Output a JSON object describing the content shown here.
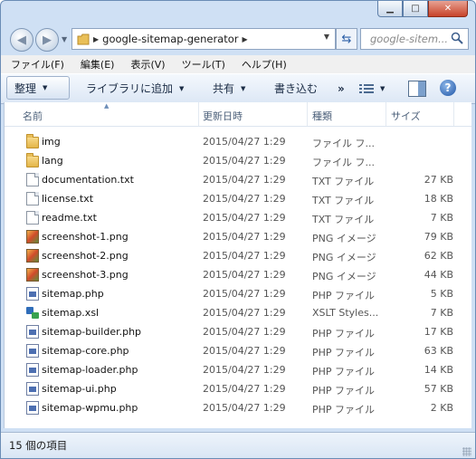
{
  "window": {
    "caption": {
      "minimize": "▁",
      "maximize": "□",
      "close": "✕"
    }
  },
  "nav": {
    "back_icon": "back-arrow-icon",
    "forward_icon": "forward-arrow-icon",
    "breadcrumb": "google-sitemap-generator",
    "search_placeholder": "google-sitem..."
  },
  "menu": [
    "ファイル(F)",
    "編集(E)",
    "表示(V)",
    "ツール(T)",
    "ヘルプ(H)"
  ],
  "toolbar": {
    "organize": "整理",
    "library": "ライブラリに追加",
    "share": "共有",
    "burn": "書き込む",
    "more": "»"
  },
  "columns": {
    "name": "名前",
    "date": "更新日時",
    "type": "種類",
    "size": "サイズ"
  },
  "files": [
    {
      "name": "img",
      "date": "2015/04/27 1:29",
      "type": "ファイル フ...",
      "size": "",
      "icon": "folder"
    },
    {
      "name": "lang",
      "date": "2015/04/27 1:29",
      "type": "ファイル フ...",
      "size": "",
      "icon": "folder"
    },
    {
      "name": "documentation.txt",
      "date": "2015/04/27 1:29",
      "type": "TXT ファイル",
      "size": "27 KB",
      "icon": "txt"
    },
    {
      "name": "license.txt",
      "date": "2015/04/27 1:29",
      "type": "TXT ファイル",
      "size": "18 KB",
      "icon": "txt"
    },
    {
      "name": "readme.txt",
      "date": "2015/04/27 1:29",
      "type": "TXT ファイル",
      "size": "7 KB",
      "icon": "txt"
    },
    {
      "name": "screenshot-1.png",
      "date": "2015/04/27 1:29",
      "type": "PNG イメージ",
      "size": "79 KB",
      "icon": "png"
    },
    {
      "name": "screenshot-2.png",
      "date": "2015/04/27 1:29",
      "type": "PNG イメージ",
      "size": "62 KB",
      "icon": "png"
    },
    {
      "name": "screenshot-3.png",
      "date": "2015/04/27 1:29",
      "type": "PNG イメージ",
      "size": "44 KB",
      "icon": "png"
    },
    {
      "name": "sitemap.php",
      "date": "2015/04/27 1:29",
      "type": "PHP ファイル",
      "size": "5 KB",
      "icon": "php"
    },
    {
      "name": "sitemap.xsl",
      "date": "2015/04/27 1:29",
      "type": "XSLT Styles...",
      "size": "7 KB",
      "icon": "xsl"
    },
    {
      "name": "sitemap-builder.php",
      "date": "2015/04/27 1:29",
      "type": "PHP ファイル",
      "size": "17 KB",
      "icon": "php"
    },
    {
      "name": "sitemap-core.php",
      "date": "2015/04/27 1:29",
      "type": "PHP ファイル",
      "size": "63 KB",
      "icon": "php"
    },
    {
      "name": "sitemap-loader.php",
      "date": "2015/04/27 1:29",
      "type": "PHP ファイル",
      "size": "14 KB",
      "icon": "php"
    },
    {
      "name": "sitemap-ui.php",
      "date": "2015/04/27 1:29",
      "type": "PHP ファイル",
      "size": "57 KB",
      "icon": "php"
    },
    {
      "name": "sitemap-wpmu.php",
      "date": "2015/04/27 1:29",
      "type": "PHP ファイル",
      "size": "2 KB",
      "icon": "php"
    }
  ],
  "status": "15 個の項目"
}
